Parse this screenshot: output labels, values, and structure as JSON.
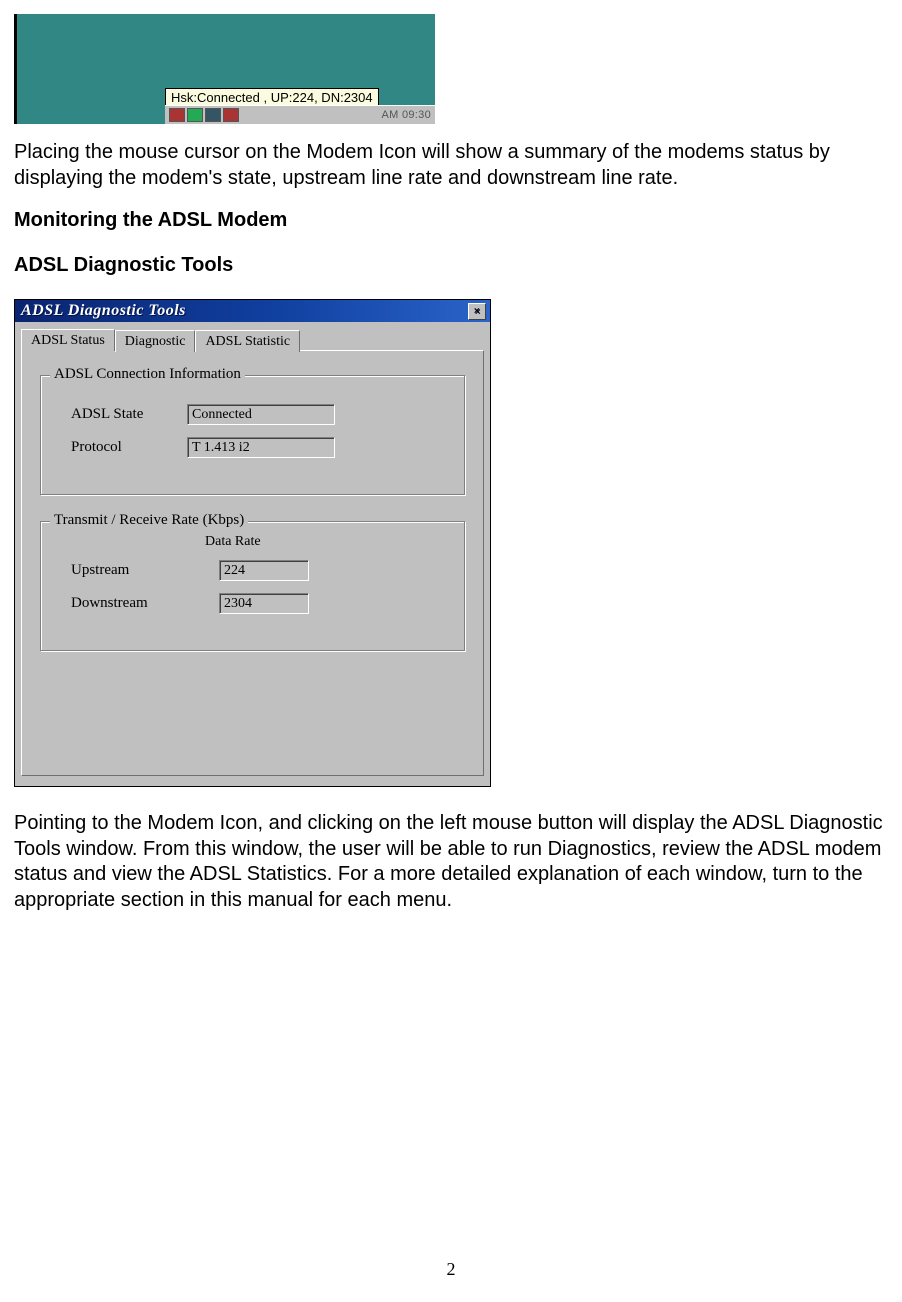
{
  "top_graphic": {
    "tooltip": "Hsk:Connected , UP:224, DN:2304",
    "clock": "AM 09:30"
  },
  "para1": "Placing the mouse cursor on the Modem Icon will show a summary of the modems status by displaying the modem's state, upstream line rate and downstream line rate.",
  "heading1": "Monitoring the ADSL Modem",
  "heading2": "ADSL Diagnostic Tools",
  "dialog": {
    "title": "ADSL Diagnostic Tools",
    "close_label": "×",
    "tabs": {
      "status": "ADSL Status",
      "diag": "Diagnostic",
      "stat": "ADSL Statistic"
    },
    "group_conn": {
      "title": "ADSL Connection Information",
      "state_label": "ADSL State",
      "state_value": "Connected",
      "proto_label": "Protocol",
      "proto_value": "T 1.413 i2"
    },
    "group_rate": {
      "title": "Transmit / Receive Rate  (Kbps)",
      "subtitle": "Data Rate",
      "up_label": "Upstream",
      "up_value": "224",
      "down_label": "Downstream",
      "down_value": "2304"
    }
  },
  "para2": "Pointing to the Modem Icon, and clicking on the left mouse button will display the ADSL Diagnostic Tools window.  From this window, the user will be able to run Diagnostics, review the ADSL modem status and view the ADSL Statistics.  For a more detailed explanation of each window, turn to the appropriate section in this manual for each menu.",
  "page_number": "2"
}
